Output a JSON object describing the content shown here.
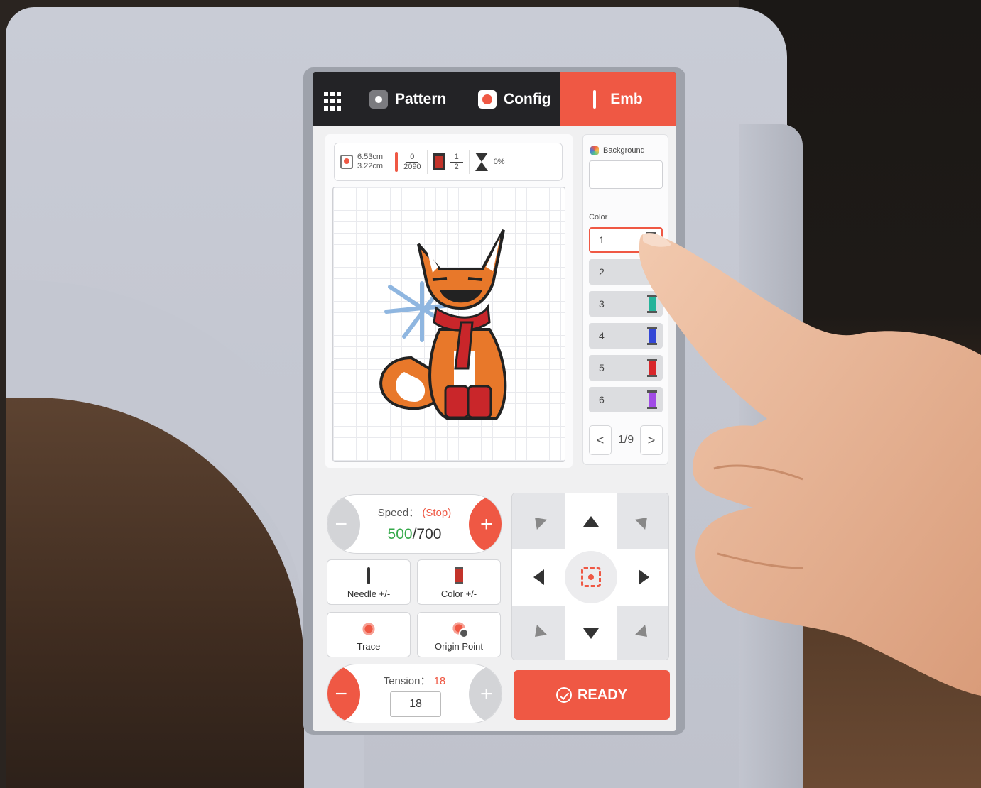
{
  "nav": {
    "tabs": [
      {
        "label": "Pattern"
      },
      {
        "label": "Config"
      },
      {
        "label": "Emb",
        "active": true
      }
    ]
  },
  "info": {
    "width": "6.53cm",
    "height": "3.22cm",
    "stitch_current": "0",
    "stitch_total": "2090",
    "color_current": "1",
    "color_total": "2",
    "progress": "0%"
  },
  "side": {
    "background_label": "Background",
    "color_label": "Color",
    "colors": [
      {
        "label": "1",
        "swatch": "#8a8a8a"
      },
      {
        "label": "2",
        "swatch": ""
      },
      {
        "label": "3",
        "swatch": "#25b39a"
      },
      {
        "label": "4",
        "swatch": "#3347d6"
      },
      {
        "label": "5",
        "swatch": "#d8262a"
      },
      {
        "label": "6",
        "swatch": "#a14be6"
      }
    ],
    "page": "1/9",
    "prev": "<",
    "next": ">"
  },
  "speed": {
    "label": "Speed：",
    "status": "(Stop)",
    "current": "500",
    "max": "/700",
    "minus": "−",
    "plus": "+"
  },
  "tiles": {
    "needle": "Needle +/-",
    "color": "Color +/-",
    "trace": "Trace",
    "origin": "Origin Point"
  },
  "tension": {
    "label": "Tension：",
    "value": "18",
    "input": "18",
    "minus": "−",
    "plus": "+"
  },
  "ready": {
    "label": "READY"
  },
  "colors": {
    "accent": "#ef5844",
    "nav_bg": "#232326",
    "speed_green": "#35a94a"
  }
}
